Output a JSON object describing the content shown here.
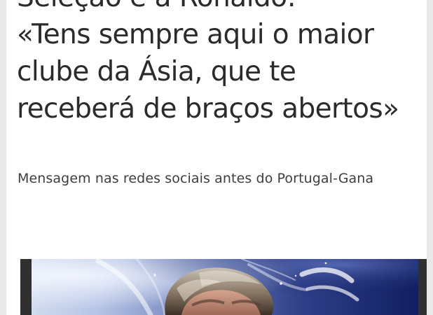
{
  "article": {
    "cropped_heading": "Seleção e a Ronaldo:",
    "headline": "«Tens sempre aqui o maior clube da Ásia, que te receberá de braços abertos»",
    "subtitle": "Mensagem nas redes sociais antes do Portugal-Gana"
  },
  "colors": {
    "page_background": "#e9e9e9",
    "card_background": "#ffffff",
    "headline_text": "#2b2b2b",
    "subtitle_text": "#3d3d3d",
    "photo_deep_blue": "#111e61"
  }
}
